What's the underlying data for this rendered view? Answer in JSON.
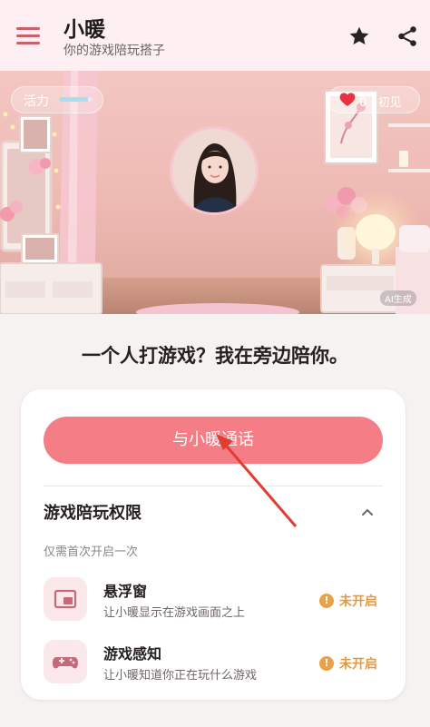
{
  "header": {
    "title": "小暖",
    "subtitle": "你的游戏陪玩搭子",
    "icons": {
      "menu": "hamburger-menu-icon",
      "favorite": "star-icon",
      "share": "share-icon"
    }
  },
  "scene": {
    "activity_label": "活力",
    "activity_level": 0.9,
    "affinity_text": "0 · 初见",
    "ai_badge": "AI生成"
  },
  "main": {
    "headline": "一个人打游戏？我在旁边陪你。",
    "call_button": "与小暖通话",
    "permissions": {
      "title": "游戏陪玩权限",
      "note": "仅需首次开启一次",
      "items": [
        {
          "name": "悬浮窗",
          "desc": "让小暖显示在游戏画面之上",
          "status": "未开启",
          "icon": "floating-window-icon"
        },
        {
          "name": "游戏感知",
          "desc": "让小暖知道你正在玩什么游戏",
          "status": "未开启",
          "icon": "gamepad-icon"
        }
      ]
    }
  },
  "colors": {
    "accent": "#f47d86",
    "header_bg": "#fdeff2",
    "status_warning": "#e09a44",
    "activity_bar": "#a8dfee"
  }
}
